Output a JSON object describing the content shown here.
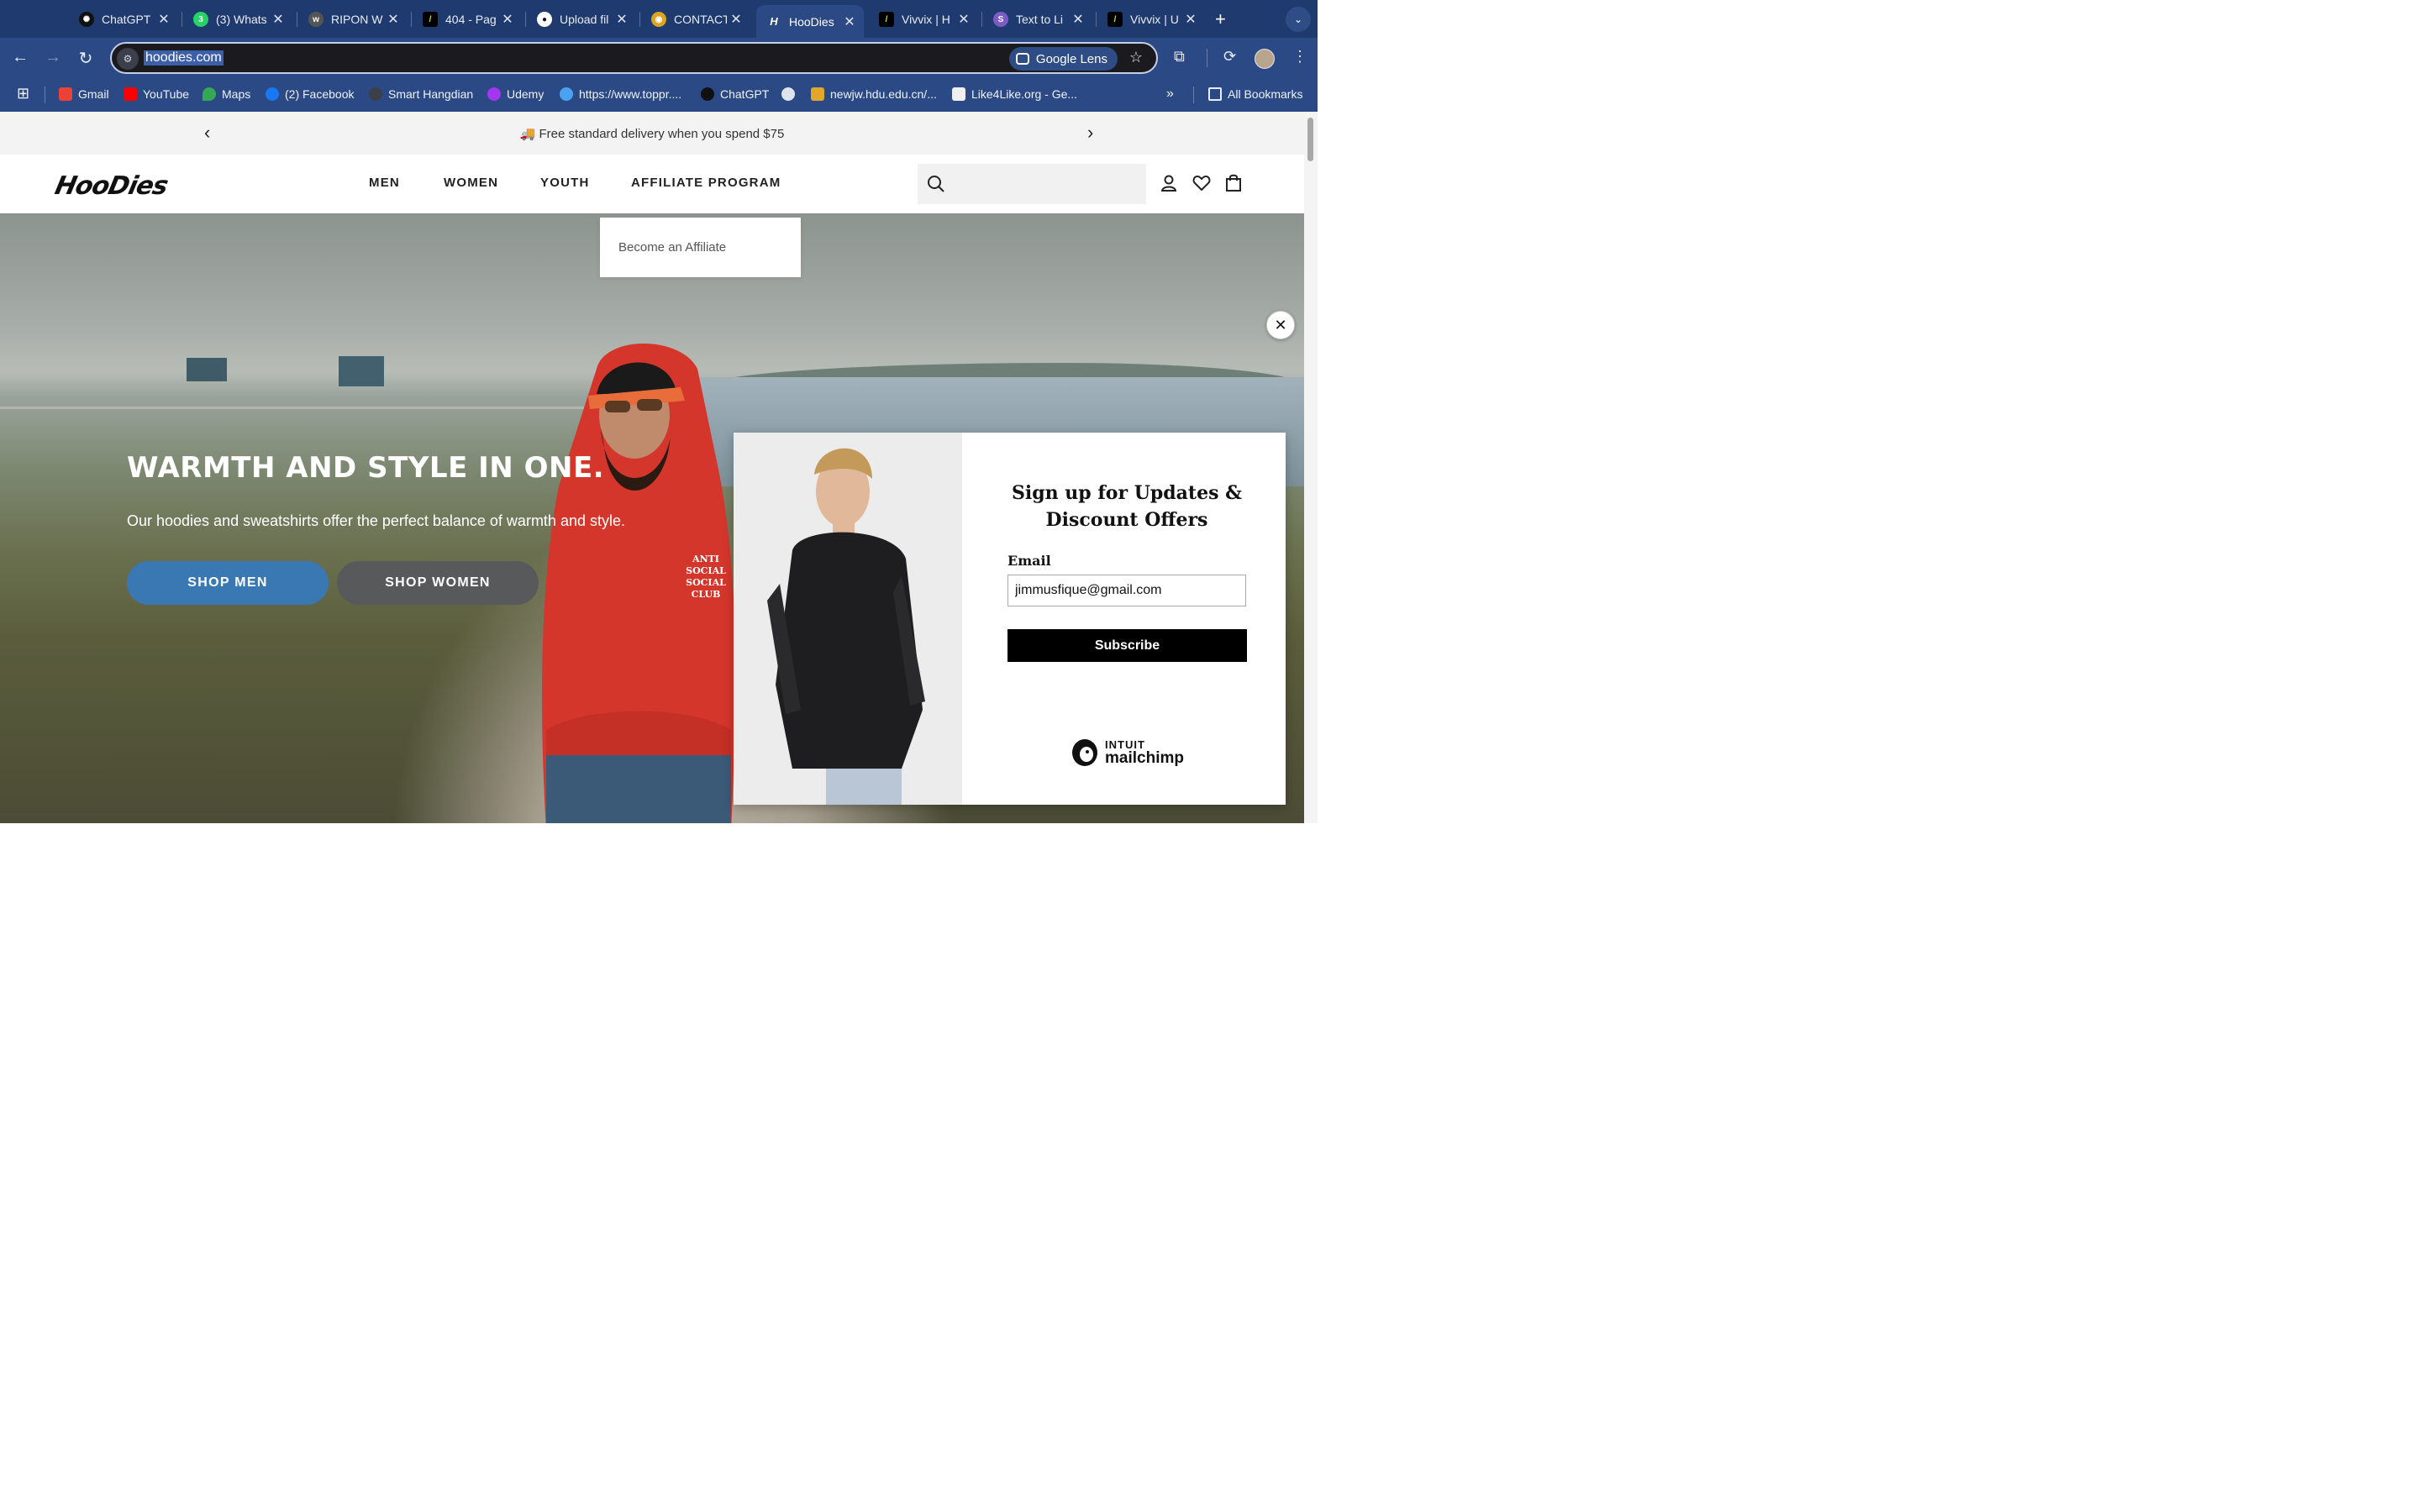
{
  "browser": {
    "tabs": [
      {
        "title": "ChatGPT",
        "icon": "chatgpt-icon",
        "color": "#111111"
      },
      {
        "title": "(3) Whats",
        "icon": "whatsapp-icon",
        "color": "#25d366"
      },
      {
        "title": "RIPON W",
        "icon": "ripon-icon",
        "color": "#6b6b6b"
      },
      {
        "title": "404 - Pag",
        "icon": "vivvix-icon",
        "color": "#c6e33a"
      },
      {
        "title": "Upload fil",
        "icon": "github-icon",
        "color": "#ffffff"
      },
      {
        "title": "CONTACT",
        "icon": "contact-icon",
        "color": "#d9a520"
      },
      {
        "title": "HooDies",
        "icon": "hoodies-icon",
        "color": "#111111",
        "active": true
      },
      {
        "title": "Vivvix | H",
        "icon": "vivvix-icon",
        "color": "#c6e33a"
      },
      {
        "title": "Text to Li",
        "icon": "speechify-icon",
        "color": "#7c5cc4"
      },
      {
        "title": "Vivvix | U",
        "icon": "vivvix-icon",
        "color": "#c6e33a"
      }
    ],
    "url": "hoodies.com",
    "lens_label": "Google Lens",
    "bookmarks": [
      {
        "label": "Gmail",
        "color": "#ea4335"
      },
      {
        "label": "YouTube",
        "color": "#ff0000"
      },
      {
        "label": "Maps",
        "color": "#34a853"
      },
      {
        "label": "(2) Facebook",
        "color": "#1877f2"
      },
      {
        "label": "Smart Hangdian",
        "color": "#3a3f4a"
      },
      {
        "label": "Udemy",
        "color": "#a435f0"
      },
      {
        "label": "https://www.toppr....",
        "color": "#4aa3f0"
      },
      {
        "label": "ChatGPT",
        "color": "#111111"
      },
      {
        "label": "",
        "color": "#dfe3ea"
      },
      {
        "label": "newjw.hdu.edu.cn/...",
        "color": "#e0a72a"
      },
      {
        "label": "Like4Like.org - Ge...",
        "color": "#f0f0f0"
      }
    ],
    "all_bookmarks": "All Bookmarks"
  },
  "site": {
    "announcement": "🚚 Free standard delivery when you spend $75",
    "logo": "HooDies",
    "nav": [
      "MEN",
      "WOMEN",
      "YOUTH",
      "AFFILIATE PROGRAM"
    ],
    "dropdown_item": "Become an Affiliate",
    "hero": {
      "title": "WARMTH AND STYLE IN ONE.",
      "subtitle": "Our hoodies and sweatshirts offer the perfect balance of warmth and style.",
      "btn_men": "SHOP MEN",
      "btn_women": "SHOP WOMEN",
      "hoodie_print": "ANTI SOCIAL SOCIAL CLUB"
    },
    "popup": {
      "title": "Sign up for Updates & Discount Offers",
      "email_label": "Email",
      "email_value": "jimmusfique@gmail.com",
      "subscribe_label": "Subscribe",
      "brand_top": "INTUIT",
      "brand_name": "mailchimp"
    }
  },
  "colors": {
    "chrome_dark": "#1f3a6e",
    "chrome": "#2b4a85",
    "shop_men": "#3a78b4",
    "shop_women": "#58595b"
  }
}
